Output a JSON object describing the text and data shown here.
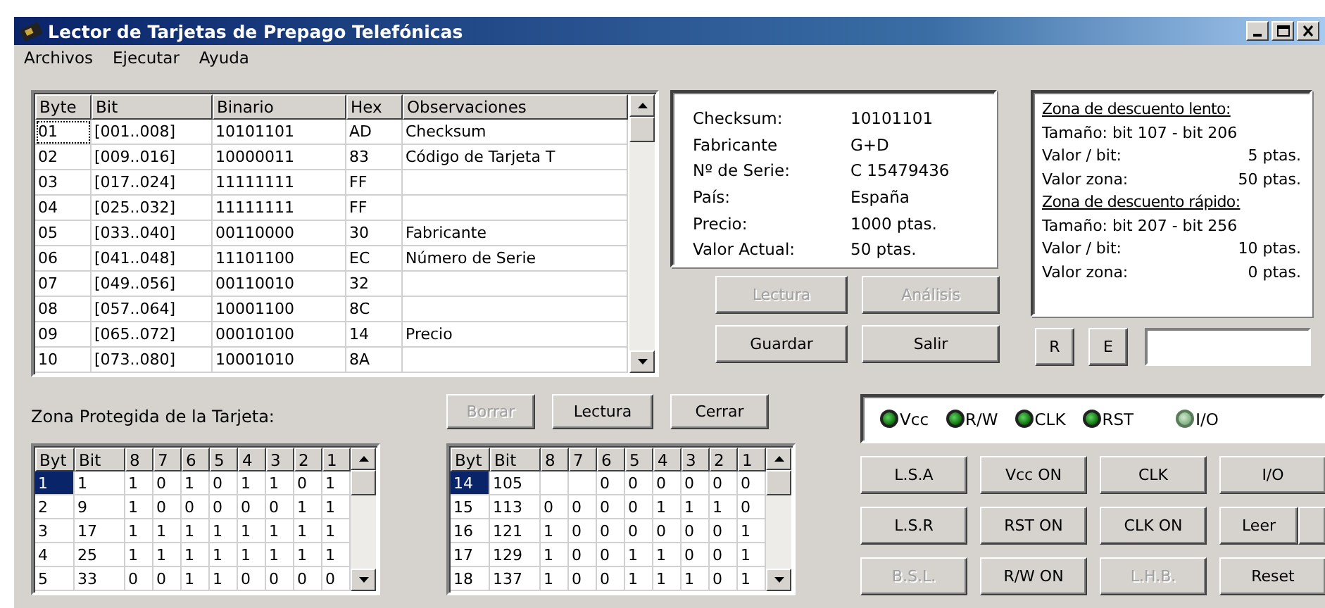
{
  "window": {
    "title": "Lector de Tarjetas de Prepago Telefónicas"
  },
  "menu": [
    "Archivos",
    "Ejecutar",
    "Ayuda"
  ],
  "card_table": {
    "columns": [
      "Byte",
      "Bit",
      "Binario",
      "Hex",
      "Observaciones"
    ],
    "rows": [
      {
        "cells": [
          "01",
          "[001..008]",
          "10101101",
          "AD",
          "Checksum"
        ],
        "selected": true
      },
      {
        "cells": [
          "02",
          "[009..016]",
          "10000011",
          "83",
          "Código de Tarjeta T"
        ],
        "selected": false
      },
      {
        "cells": [
          "03",
          "[017..024]",
          "11111111",
          "FF",
          null
        ],
        "selected": false
      },
      {
        "cells": [
          "04",
          "[025..032]",
          "11111111",
          "FF",
          null
        ],
        "selected": false
      },
      {
        "cells": [
          "05",
          "[033..040]",
          "00110000",
          "30",
          "Fabricante"
        ],
        "selected": false
      },
      {
        "cells": [
          "06",
          "[041..048]",
          "11101100",
          "EC",
          "Número de Serie"
        ],
        "selected": false
      },
      {
        "cells": [
          "07",
          "[049..056]",
          "00110010",
          "32",
          null
        ],
        "selected": false
      },
      {
        "cells": [
          "08",
          "[057..064]",
          "10001100",
          "8C",
          null
        ],
        "selected": false
      },
      {
        "cells": [
          "09",
          "[065..072]",
          "00010100",
          "14",
          "Precio"
        ],
        "selected": false
      },
      {
        "cells": [
          "10",
          "[073..080]",
          "10001010",
          "8A",
          null
        ],
        "selected": false
      }
    ]
  },
  "card_info": [
    {
      "label": "Checksum:",
      "value": "10101101"
    },
    {
      "label": "Fabricante",
      "value": "G+D"
    },
    {
      "label": "Nº de Serie:",
      "value": "C 15479436"
    },
    {
      "label": "País:",
      "value": "España"
    },
    {
      "label": "Precio:",
      "value": "1000 ptas."
    },
    {
      "label": "Valor Actual:",
      "value": "50 ptas."
    }
  ],
  "discount_zones": [
    {
      "title": "Zona de descuento lento:",
      "size": "Tamaño: bit 107 - bit 206",
      "items": [
        {
          "label": "Valor / bit:",
          "value": "5 ptas."
        },
        {
          "label": "Valor zona:",
          "value": "50 ptas."
        }
      ]
    },
    {
      "title": "Zona de descuento rápido:",
      "size": "Tamaño: bit 207 - bit 256",
      "items": [
        {
          "label": "Valor / bit:",
          "value": "10 ptas."
        },
        {
          "label": "Valor zona:",
          "value": "0 ptas."
        }
      ]
    }
  ],
  "info_buttons": [
    {
      "label": "Lectura",
      "disabled": true
    },
    {
      "label": "Análisis",
      "disabled": true
    },
    {
      "label": "Guardar",
      "disabled": false
    },
    {
      "label": "Salir",
      "disabled": false
    }
  ],
  "register_buttons": [
    "R",
    "E"
  ],
  "protected_zone": {
    "label": "Zona Protegida de la Tarjeta:"
  },
  "zone_buttons": [
    {
      "label": "Borrar",
      "disabled": true
    },
    {
      "label": "Lectura",
      "disabled": false
    },
    {
      "label": "Cerrar",
      "disabled": false
    }
  ],
  "bit_tables": [
    {
      "columns": [
        "Byt",
        "Bit",
        "8",
        "7",
        "6",
        "5",
        "4",
        "3",
        "2",
        "1"
      ],
      "rows": [
        {
          "cells": [
            "1",
            "1",
            "1",
            "0",
            "1",
            "0",
            "1",
            "1",
            "0",
            "1"
          ],
          "selected": true
        },
        {
          "cells": [
            "2",
            "9",
            "1",
            "0",
            "0",
            "0",
            "0",
            "0",
            "1",
            "1"
          ],
          "selected": false
        },
        {
          "cells": [
            "3",
            "17",
            "1",
            "1",
            "1",
            "1",
            "1",
            "1",
            "1",
            "1"
          ],
          "selected": false
        },
        {
          "cells": [
            "4",
            "25",
            "1",
            "1",
            "1",
            "1",
            "1",
            "1",
            "1",
            "1"
          ],
          "selected": false
        },
        {
          "cells": [
            "5",
            "33",
            "0",
            "0",
            "1",
            "1",
            "0",
            "0",
            "0",
            "0"
          ],
          "selected": false
        }
      ]
    },
    {
      "columns": [
        "Byt",
        "Bit",
        "8",
        "7",
        "6",
        "5",
        "4",
        "3",
        "2",
        "1"
      ],
      "rows": [
        {
          "cells": [
            "14",
            "105",
            null,
            null,
            "0",
            "0",
            "0",
            "0",
            "0",
            "0"
          ],
          "selected": true
        },
        {
          "cells": [
            "15",
            "113",
            "0",
            "0",
            "0",
            "0",
            "1",
            "1",
            "1",
            "0"
          ],
          "selected": false
        },
        {
          "cells": [
            "16",
            "121",
            "1",
            "0",
            "0",
            "0",
            "0",
            "0",
            "0",
            "1"
          ],
          "selected": false
        },
        {
          "cells": [
            "17",
            "129",
            "1",
            "0",
            "0",
            "1",
            "1",
            "0",
            "0",
            "1"
          ],
          "selected": false
        },
        {
          "cells": [
            "18",
            "137",
            "1",
            "0",
            "0",
            "1",
            "1",
            "1",
            "0",
            "1"
          ],
          "selected": false
        }
      ]
    }
  ],
  "signals": [
    {
      "label": "Vcc",
      "on": true
    },
    {
      "label": "R/W",
      "on": true
    },
    {
      "label": "CLK",
      "on": true
    },
    {
      "label": "RST",
      "on": true
    },
    {
      "label": "I/O",
      "on": false
    }
  ],
  "controls": [
    {
      "label": "L.S.A",
      "disabled": false,
      "kind": "plain"
    },
    {
      "label": "Vcc ON",
      "disabled": false,
      "kind": "plain"
    },
    {
      "label": "CLK",
      "disabled": false,
      "kind": "plain"
    },
    {
      "label": "I/O",
      "disabled": false,
      "kind": "plain"
    },
    {
      "label": "L.S.R",
      "disabled": false,
      "kind": "plain"
    },
    {
      "label": "RST ON",
      "disabled": false,
      "kind": "plain"
    },
    {
      "label": "CLK ON",
      "disabled": false,
      "kind": "plain"
    },
    {
      "label": "Leer",
      "disabled": false,
      "kind": "split"
    },
    {
      "label": "B.S.L.",
      "disabled": true,
      "kind": "plain"
    },
    {
      "label": "R/W ON",
      "disabled": false,
      "kind": "plain"
    },
    {
      "label": "L.H.B.",
      "disabled": true,
      "kind": "plain"
    },
    {
      "label": "Reset",
      "disabled": false,
      "kind": "plain"
    }
  ]
}
